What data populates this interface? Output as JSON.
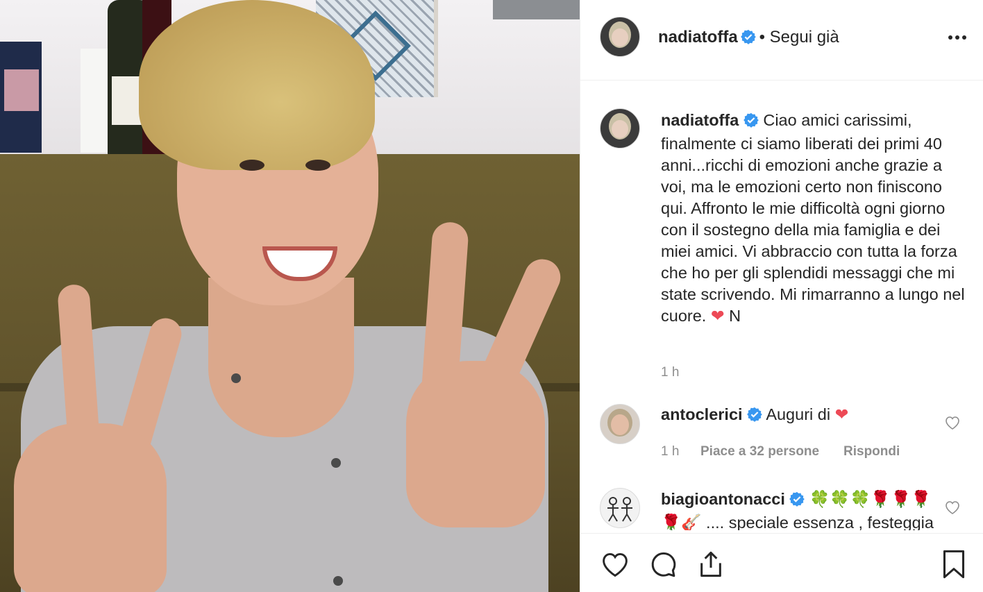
{
  "post": {
    "author": "nadiatoffa",
    "follow_status": "Segui già",
    "caption": "Ciao amici carissimi, finalmente ci siamo liberati dei primi 40 anni...ricchi di emozioni anche grazie a voi, ma le emozioni certo non finiscono qui. Affronto le mie difficoltà ogni giorno con il sostegno della mia famiglia e dei miei amici. Vi abbraccio con tutta la forza che ho per gli splendidi messaggi che mi state scrivendo. Mi rimarranno a lungo nel cuore.",
    "caption_sign": "N",
    "time": "1 h"
  },
  "comments": [
    {
      "author": "antoclerici",
      "text": "Auguri di",
      "time": "1 h",
      "likes": "Piace a 32 persone",
      "reply": "Rispondi"
    },
    {
      "author": "biagioantonacci",
      "text_line1": "🍀🍀🍀🌹🌹🌹",
      "text_line2": "🌹🎸 .... speciale essenza , festeggia"
    }
  ],
  "icons": {
    "more": "more-options-icon",
    "like": "heart-icon",
    "comment": "comment-icon",
    "share": "share-icon",
    "save": "bookmark-icon"
  },
  "colors": {
    "verified": "#3897f0",
    "heart": "#ed4956",
    "muted": "#8e8e8e"
  }
}
